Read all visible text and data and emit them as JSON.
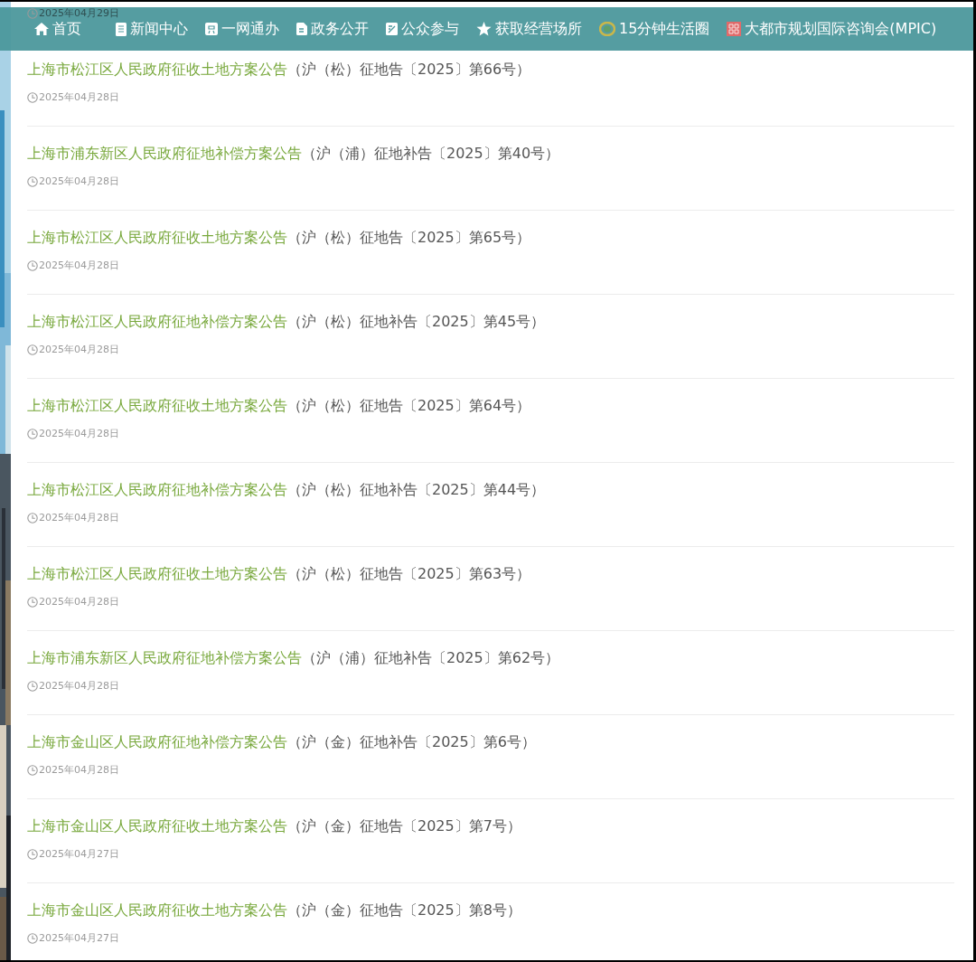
{
  "nav": {
    "items": [
      {
        "label": "首页"
      },
      {
        "label": "新闻中心"
      },
      {
        "label": "一网通办"
      },
      {
        "label": "政务公开"
      },
      {
        "label": "公众参与"
      },
      {
        "label": "获取经营场所"
      },
      {
        "label": "15分钟生活圈"
      },
      {
        "label": "大都市规划国际咨询会(MPIC)"
      }
    ]
  },
  "top_date": "2025年04月29日",
  "notices": [
    {
      "title": "上海市松江区人民政府征收土地方案公告",
      "number": "（沪（松）征地告〔2025〕第66号）",
      "date": "2025年04月28日"
    },
    {
      "title": "上海市浦东新区人民政府征地补偿方案公告",
      "number": "（沪（浦）征地补告〔2025〕第40号）",
      "date": "2025年04月28日"
    },
    {
      "title": "上海市松江区人民政府征收土地方案公告",
      "number": "（沪（松）征地告〔2025〕第65号）",
      "date": "2025年04月28日"
    },
    {
      "title": "上海市松江区人民政府征地补偿方案公告",
      "number": "（沪（松）征地补告〔2025〕第45号）",
      "date": "2025年04月28日"
    },
    {
      "title": "上海市松江区人民政府征收土地方案公告",
      "number": "（沪（松）征地告〔2025〕第64号）",
      "date": "2025年04月28日"
    },
    {
      "title": "上海市松江区人民政府征地补偿方案公告",
      "number": "（沪（松）征地补告〔2025〕第44号）",
      "date": "2025年04月28日"
    },
    {
      "title": "上海市松江区人民政府征收土地方案公告",
      "number": "（沪（松）征地告〔2025〕第63号）",
      "date": "2025年04月28日"
    },
    {
      "title": "上海市浦东新区人民政府征地补偿方案公告",
      "number": "（沪（浦）征地补告〔2025〕第62号）",
      "date": "2025年04月28日"
    },
    {
      "title": "上海市金山区人民政府征地补偿方案公告",
      "number": "（沪（金）征地补告〔2025〕第6号）",
      "date": "2025年04月28日"
    },
    {
      "title": "上海市金山区人民政府征收土地方案公告",
      "number": "（沪（金）征地告〔2025〕第7号）",
      "date": "2025年04月27日"
    },
    {
      "title": "上海市金山区人民政府征收土地方案公告",
      "number": "（沪（金）征地告〔2025〕第8号）",
      "date": "2025年04月27日"
    }
  ]
}
